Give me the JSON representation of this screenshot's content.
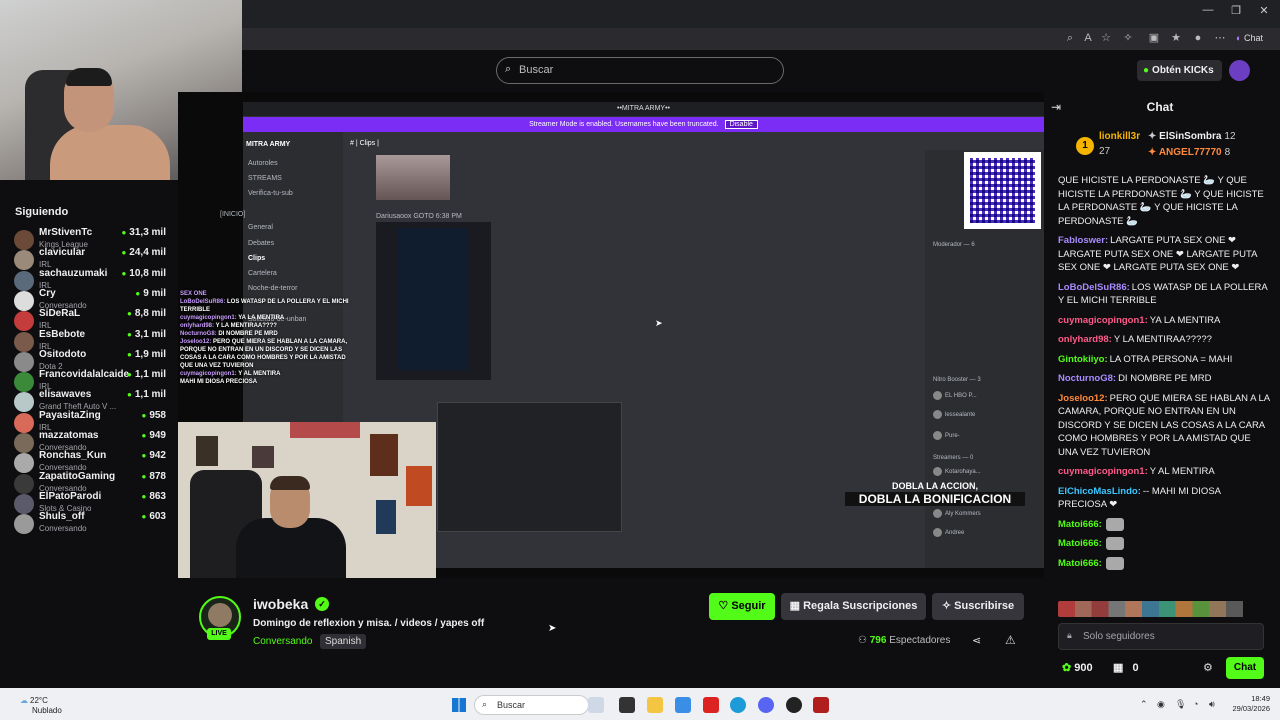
{
  "browser": {
    "chat_label": "Chat"
  },
  "header": {
    "search_placeholder": "Buscar",
    "kicks_label": "Obtén KICKs"
  },
  "sidebar": {
    "title": "Siguiendo",
    "channels": [
      {
        "name": "MrStivenTc",
        "category": "Kings League",
        "viewers": "31,3 mil",
        "color": "#6b4a3a"
      },
      {
        "name": "clavicular",
        "category": "IRL",
        "viewers": "24,4 mil",
        "color": "#9a8a7a"
      },
      {
        "name": "sachauzumaki",
        "category": "IRL",
        "viewers": "10,8 mil",
        "color": "#5a6a7a"
      },
      {
        "name": "Cry",
        "category": "Conversando",
        "viewers": "9 mil",
        "color": "#dddddd"
      },
      {
        "name": "SiDeRaL",
        "category": "IRL",
        "viewers": "8,8 mil",
        "color": "#c43c3c"
      },
      {
        "name": "EsBebote",
        "category": "IRL",
        "viewers": "3,1 mil",
        "color": "#7a5a4a"
      },
      {
        "name": "Ositodoto",
        "category": "Dota 2",
        "viewers": "1,9 mil",
        "color": "#8a8a8a"
      },
      {
        "name": "Francovidalalcaide",
        "category": "IRL",
        "viewers": "1,1 mil",
        "color": "#3a8a3a"
      },
      {
        "name": "elisawaves",
        "category": "Grand Theft Auto V ...",
        "viewers": "1,1 mil",
        "color": "#b8c8c8"
      },
      {
        "name": "PayasitaZing",
        "category": "IRL",
        "viewers": "958",
        "color": "#d86a5a"
      },
      {
        "name": "mazzatomas",
        "category": "Conversando",
        "viewers": "949",
        "color": "#7a6a5a"
      },
      {
        "name": "Ronchas_Kun",
        "category": "Conversando",
        "viewers": "942",
        "color": "#aaaaaa"
      },
      {
        "name": "ZapatitoGaming",
        "category": "Conversando",
        "viewers": "878",
        "color": "#3a3a3a"
      },
      {
        "name": "ElPatoParodi",
        "category": "Slots & Casino",
        "viewers": "863",
        "color": "#5a5a6a"
      },
      {
        "name": "Shuls_off",
        "category": "Conversando",
        "viewers": "603",
        "color": "#9a9a9a"
      }
    ]
  },
  "video": {
    "discord_title": "••MITRA ARMY••",
    "streamer_banner": "Streamer Mode is enabled. Usernames have been truncated.",
    "banner_button": "Disable",
    "server_name": "MITRA ARMY",
    "channels": [
      "Autoroles",
      "STREAMS",
      "Verifica-tu-sub",
      "[INICIO]",
      "General",
      "Debates",
      "Clips",
      "Cartelera",
      "Noche-de-terror",
      "Solicitud-de-unban"
    ],
    "clips_header": "# | Clips |",
    "message_author": "Dariusaoox  GOTO  6:38 PM",
    "members": [
      "Moderador — 6",
      "Nitro Booster — 3",
      "EL HBO P...",
      "lessealante",
      "Pure-",
      "Streamers — 0",
      "Kotarohaya...",
      "Aly Kommers",
      "Andree"
    ],
    "overlay_line1": "DOBLA LA ACCION,",
    "overlay_line2": "DOBLA LA BONIFICACION",
    "overlay_chat": [
      {
        "user": "SEX ONE",
        "text": ""
      },
      {
        "user": "LoBoDelSuR86:",
        "text": "LOS WATASP DE LA POLLERA Y EL MICHI TERRIBLE"
      },
      {
        "user": "cuymagicopingon1:",
        "text": "YA LA MENTIRA"
      },
      {
        "user": "onlyhard98:",
        "text": "Y LA MENTIRAA????"
      },
      {
        "user": "NocturnoG8:",
        "text": "DI NOMBRE PE MRD"
      },
      {
        "user": "Joseloo12:",
        "text": "PERO QUE MIERA SE HABLAN A LA CAMARA, PORQUE NO ENTRAN EN UN DISCORD Y SE DICEN LAS COSAS A LA CARA COMO HOMBRES Y POR LA AMISTAD QUE UNA VEZ TUVIERON"
      },
      {
        "user": "cuymagicopingon1:",
        "text": "Y AL MENTIRA"
      },
      {
        "user": "",
        "text": "MAHI MI DIOSA PRECIOSA"
      }
    ]
  },
  "stream": {
    "streamer": "iwobeka",
    "live_badge": "LIVE",
    "title": "Domingo de reflexion y misa.  /   videos / yapes off",
    "category": "Conversando",
    "language": "Spanish",
    "follow_label": "Seguir",
    "gift_label": "Regala Suscripciones",
    "subscribe_label": "Suscribirse",
    "viewer_count": "796",
    "viewer_label": "Espectadores"
  },
  "chat": {
    "title": "Chat",
    "top_gifters": [
      {
        "rank": "1",
        "name": "lionkill3r",
        "count": "27",
        "color": "#f5b400"
      },
      {
        "name": "ElSinSombra",
        "count": "12",
        "color": "#ffffff"
      },
      {
        "name": "ANGEL77770",
        "count": "8",
        "color": "#ff8a3c"
      }
    ],
    "messages": [
      {
        "user": "",
        "color": "#efeff1",
        "text": "QUE HICISTE LA PERDONASTE 🦢 Y QUE HICISTE LA PERDONASTE 🦢 Y QUE HICISTE LA PERDONASTE 🦢 Y QUE HICISTE LA PERDONASTE 🦢"
      },
      {
        "user": "Fabloswer:",
        "color": "#a88bff",
        "text": "LARGATE PUTA SEX ONE ❤ LARGATE PUTA SEX ONE ❤ LARGATE PUTA SEX ONE ❤ LARGATE PUTA SEX ONE ❤"
      },
      {
        "user": "LoBoDelSuR86:",
        "color": "#a88bff",
        "text": "LOS WATASP DE LA POLLERA Y EL MICHI TERRIBLE"
      },
      {
        "user": "cuymagicopingon1:",
        "color": "#ff5a8a",
        "text": "YA LA MENTIRA"
      },
      {
        "user": "onlyhard98:",
        "color": "#ff5a8a",
        "text": "Y LA MENTIRAA?????"
      },
      {
        "user": "Gintokiiyo:",
        "color": "#53fc18",
        "text": "LA OTRA PERSONA = MAHI"
      },
      {
        "user": "NocturnoG8:",
        "color": "#a88bff",
        "text": "DI NOMBRE PE MRD"
      },
      {
        "user": "Joseloo12:",
        "color": "#ff8a3c",
        "text": "PERO QUE MIERA SE HABLAN A LA CAMARA, PORQUE NO ENTRAN EN UN DISCORD Y SE DICEN LAS COSAS A LA CARA COMO HOMBRES Y POR LA AMISTAD QUE UNA VEZ TUVIERON"
      },
      {
        "user": "cuymagicopingon1:",
        "color": "#ff5a8a",
        "text": "Y AL MENTIRA"
      },
      {
        "user": "ElChicoMasLindo:",
        "color": "#3cc8ff",
        "text": "-- MAHI MI DIOSA PRECIOSA ❤"
      },
      {
        "user": "Matoi666:",
        "color": "#53fc18",
        "text": ""
      },
      {
        "user": "Matoi666:",
        "color": "#53fc18",
        "text": ""
      },
      {
        "user": "Matoi666:",
        "color": "#53fc18",
        "text": ""
      }
    ],
    "input_placeholder": "Solo seguidores",
    "points": "900",
    "gifts": "0",
    "send_label": "Chat"
  },
  "taskbar": {
    "temperature": "22°C",
    "weather": "Nublado",
    "search_label": "Buscar",
    "time": "18:49",
    "date": "29/03/2026"
  },
  "colors": {
    "accent": "#53fc18",
    "background": "#0e0e10",
    "discord_banner": "#7b2cf5"
  }
}
